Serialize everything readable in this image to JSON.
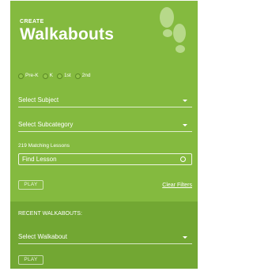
{
  "header": {
    "eyebrow": "CREATE",
    "title": "Walkabouts"
  },
  "grades": [
    {
      "label": "Pre-K"
    },
    {
      "label": "K"
    },
    {
      "label": "1st"
    },
    {
      "label": "2nd"
    }
  ],
  "subject_select": {
    "label": "Select Subject"
  },
  "subcategory_select": {
    "label": "Select Subcategory"
  },
  "lessons": {
    "count_text": "219 Matching Lessons"
  },
  "find_lesson": {
    "value": "Find Lesson"
  },
  "actions": {
    "play_label": "PLAY",
    "clear_filters_label": "Clear Filters"
  },
  "recent": {
    "title": "RECENT WALKABOUTS:",
    "select_label": "Select Walkabout",
    "play_label": "PLAY"
  },
  "colors": {
    "panel": "#84ba3f",
    "recent_panel": "#72a733",
    "footprint": "#b7d98a"
  },
  "icons": {
    "logo": "footprints-icon"
  }
}
